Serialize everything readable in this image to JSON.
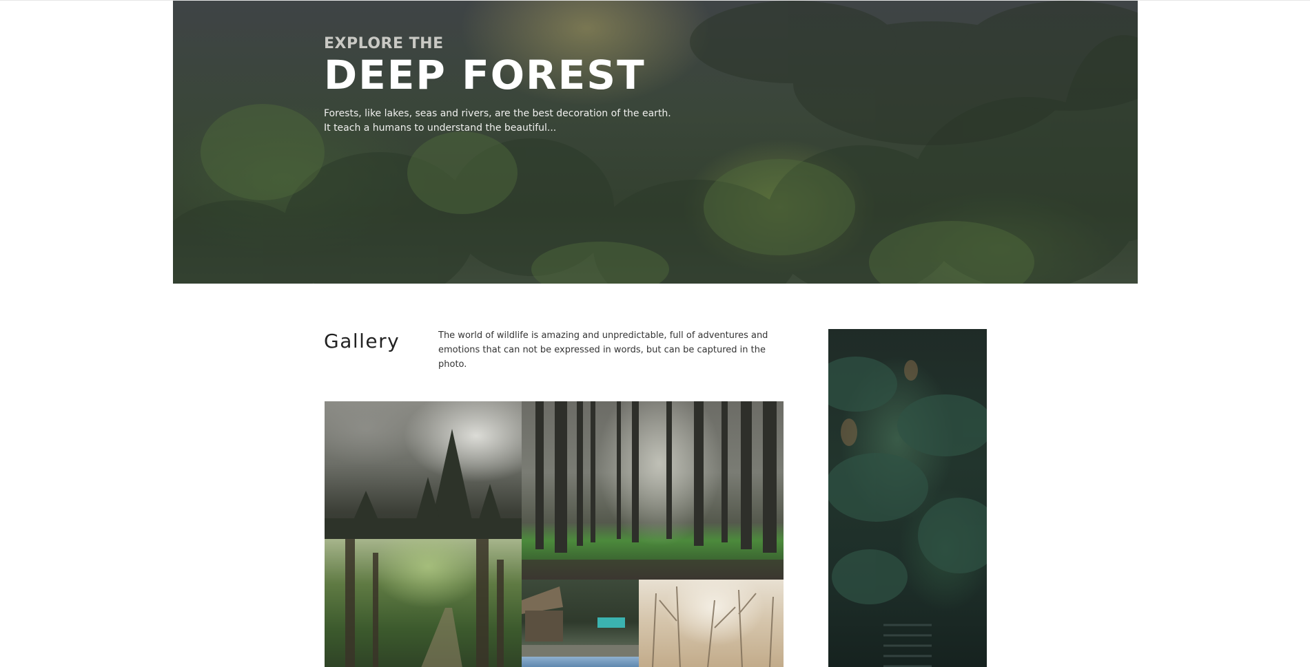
{
  "hero": {
    "kicker": "EXPLORE THE",
    "title": "DEEP FOREST",
    "description_line1": "Forests, like lakes, seas and rivers, are the best decoration of the earth.",
    "description_line2": "It teach a humans to understand the beautiful..."
  },
  "gallery": {
    "title": "Gallery",
    "description_line1": "The world of wildlife is amazing and unpredictable, full of adventures and",
    "description_line2": "emotions that can not be expressed in words, but can be captured in the photo.",
    "photos": [
      {
        "name": "foggy-pine-forest"
      },
      {
        "name": "tall-trees-green-grass"
      },
      {
        "name": "green-forest-path"
      },
      {
        "name": "forest-cabin"
      },
      {
        "name": "misty-bare-trees"
      },
      {
        "name": "dark-fir-branches"
      }
    ]
  },
  "colors": {
    "hero_overlay": "#3f4446",
    "heading_text": "#222222",
    "body_text": "#333333",
    "background": "#ffffff"
  }
}
